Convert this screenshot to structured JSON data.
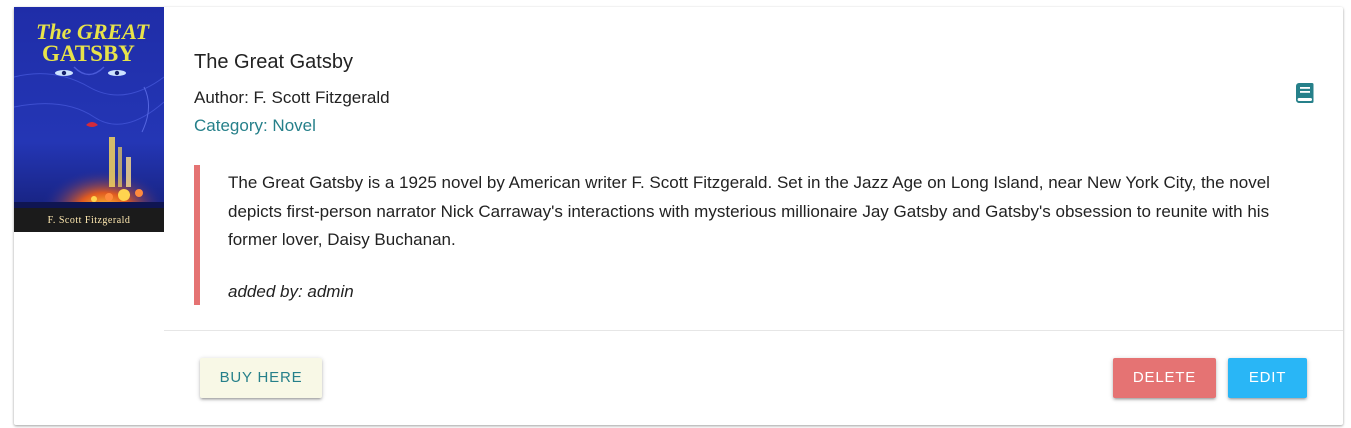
{
  "book": {
    "cover": {
      "title_line1": "The GREAT",
      "title_line2": "GATSBY",
      "author_caption": "F. Scott Fitzgerald"
    },
    "title": "The Great Gatsby",
    "author_text": "Author: F. Scott Fitzgerald",
    "category_text": "Category: Novel",
    "description": "The Great Gatsby is a 1925 novel by American writer F. Scott Fitzgerald. Set in the Jazz Age on Long Island, near New York City, the novel depicts first-person narrator Nick Carraway's interactions with mysterious millionaire Jay Gatsby and Gatsby's obsession to reunite with his former lover, Daisy Buchanan.",
    "added_by": "added by: admin",
    "icon": "book-icon"
  },
  "actions": {
    "buy_label": "BUY HERE",
    "delete_label": "DELETE",
    "edit_label": "EDIT"
  },
  "colors": {
    "accent_teal": "#26808a",
    "delete_red": "#e57373",
    "edit_blue": "#29b6f6",
    "buy_bg": "#f8f8e6",
    "quote_border": "#e57373"
  }
}
